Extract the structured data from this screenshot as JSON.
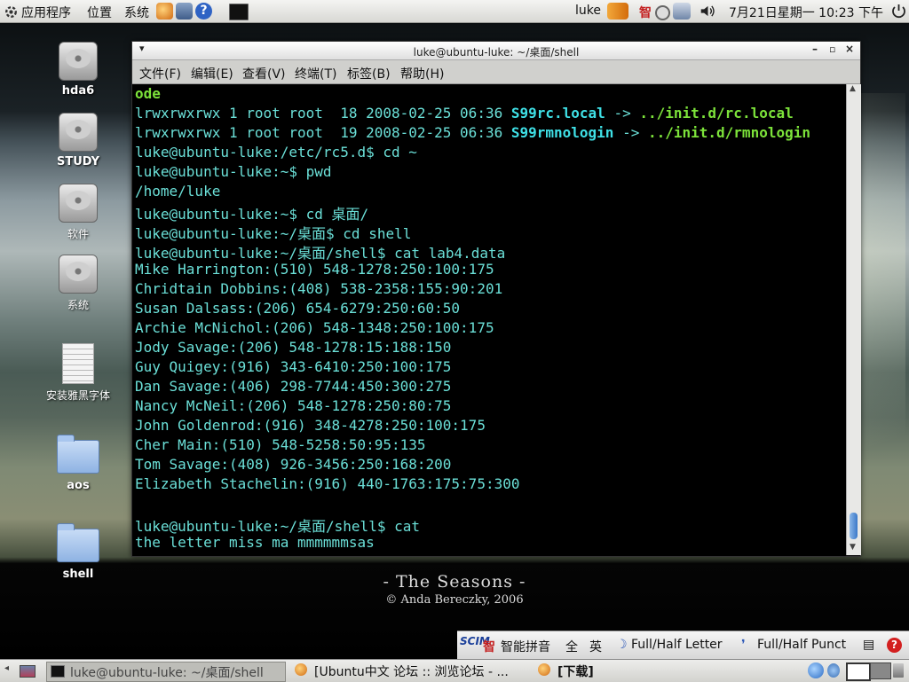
{
  "top_panel": {
    "menu_apps": "应用程序",
    "menu_places": "位置",
    "menu_system": "系统",
    "user": "luke",
    "clock": "7月21日星期一 10:23 下午",
    "icons": [
      "launcher-icon",
      "web-browser-icon",
      "mail-icon",
      "help-icon",
      "terminal-icon",
      "network-icon",
      "ime-icon",
      "record-icon",
      "network-monitor-icon",
      "volume-icon",
      "power-icon"
    ]
  },
  "desktop_icons": [
    "hda6",
    "STUDY",
    "软件",
    "系统",
    "安装雅黑字体",
    "aos",
    "shell"
  ],
  "terminal": {
    "title": "luke@ubuntu-luke: ~/桌面/shell",
    "menus": [
      "文件(F)",
      "编辑(E)",
      "查看(V)",
      "终端(T)",
      "标签(B)",
      "帮助(H)"
    ],
    "lines": [
      {
        "parts": [
          {
            "t": "ode",
            "c": "green"
          }
        ]
      },
      {
        "parts": [
          {
            "t": "lrwxrwxrwx 1 root root  18 2008-02-25 06:36 ",
            "c": ""
          },
          {
            "t": "S99rc.local",
            "c": "link"
          },
          {
            "t": " -> ",
            "c": ""
          },
          {
            "t": "../init.d/rc.local",
            "c": "green"
          }
        ]
      },
      {
        "parts": [
          {
            "t": "lrwxrwxrwx 1 root root  19 2008-02-25 06:36 ",
            "c": ""
          },
          {
            "t": "S99rmnologin",
            "c": "link"
          },
          {
            "t": " -> ",
            "c": ""
          },
          {
            "t": "../init.d/rmnologin",
            "c": "green"
          }
        ]
      },
      {
        "parts": [
          {
            "t": "luke@ubuntu-luke:/etc/rc5.d$ cd ~",
            "c": ""
          }
        ]
      },
      {
        "parts": [
          {
            "t": "luke@ubuntu-luke:~$ pwd",
            "c": ""
          }
        ]
      },
      {
        "parts": [
          {
            "t": "/home/luke",
            "c": ""
          }
        ]
      },
      {
        "parts": [
          {
            "t": "luke@ubuntu-luke:~$ cd 桌面/",
            "c": ""
          }
        ]
      },
      {
        "parts": [
          {
            "t": "luke@ubuntu-luke:~/桌面$ cd shell",
            "c": ""
          }
        ]
      },
      {
        "parts": [
          {
            "t": "luke@ubuntu-luke:~/桌面/shell$ cat lab4.data",
            "c": ""
          }
        ]
      },
      {
        "parts": [
          {
            "t": "Mike Harrington:(510) 548-1278:250:100:175",
            "c": ""
          }
        ]
      },
      {
        "parts": [
          {
            "t": "Chridtain Dobbins:(408) 538-2358:155:90:201",
            "c": ""
          }
        ]
      },
      {
        "parts": [
          {
            "t": "Susan Dalsass:(206) 654-6279:250:60:50",
            "c": ""
          }
        ]
      },
      {
        "parts": [
          {
            "t": "Archie McNichol:(206) 548-1348:250:100:175",
            "c": ""
          }
        ]
      },
      {
        "parts": [
          {
            "t": "Jody Savage:(206) 548-1278:15:188:150",
            "c": ""
          }
        ]
      },
      {
        "parts": [
          {
            "t": "Guy Quigey:(916) 343-6410:250:100:175",
            "c": ""
          }
        ]
      },
      {
        "parts": [
          {
            "t": "Dan Savage:(406) 298-7744:450:300:275",
            "c": ""
          }
        ]
      },
      {
        "parts": [
          {
            "t": "Nancy McNeil:(206) 548-1278:250:80:75",
            "c": ""
          }
        ]
      },
      {
        "parts": [
          {
            "t": "John Goldenrod:(916) 348-4278:250:100:175",
            "c": ""
          }
        ]
      },
      {
        "parts": [
          {
            "t": "Cher Main:(510) 548-5258:50:95:135",
            "c": ""
          }
        ]
      },
      {
        "parts": [
          {
            "t": "Tom Savage:(408) 926-3456:250:168:200",
            "c": ""
          }
        ]
      },
      {
        "parts": [
          {
            "t": "Elizabeth Stachelin:(916) 440-1763:175:75:300",
            "c": ""
          }
        ]
      },
      {
        "parts": [
          {
            "t": "",
            "c": ""
          }
        ]
      },
      {
        "parts": [
          {
            "t": "luke@ubuntu-luke:~/桌面/shell$ cat",
            "c": ""
          }
        ]
      },
      {
        "parts": [
          {
            "t": "the letter miss ma mmmmmmsas",
            "c": ""
          }
        ]
      }
    ]
  },
  "wallpaper": {
    "title": "- The Seasons -",
    "credit": "© Anda Bereczky, 2006"
  },
  "ime_bar": {
    "mode": "智能拼音",
    "full": "全",
    "lang": "英",
    "letter": "Full/Half Letter",
    "punct": "Full/Half Punct"
  },
  "taskbar": [
    {
      "label": "luke@ubuntu-luke: ~/桌面/shell",
      "active": true
    },
    {
      "label": "[Ubuntu中文 论坛 :: 浏览论坛 - ...",
      "active": false
    },
    {
      "label": "[下载]",
      "active": false
    }
  ]
}
